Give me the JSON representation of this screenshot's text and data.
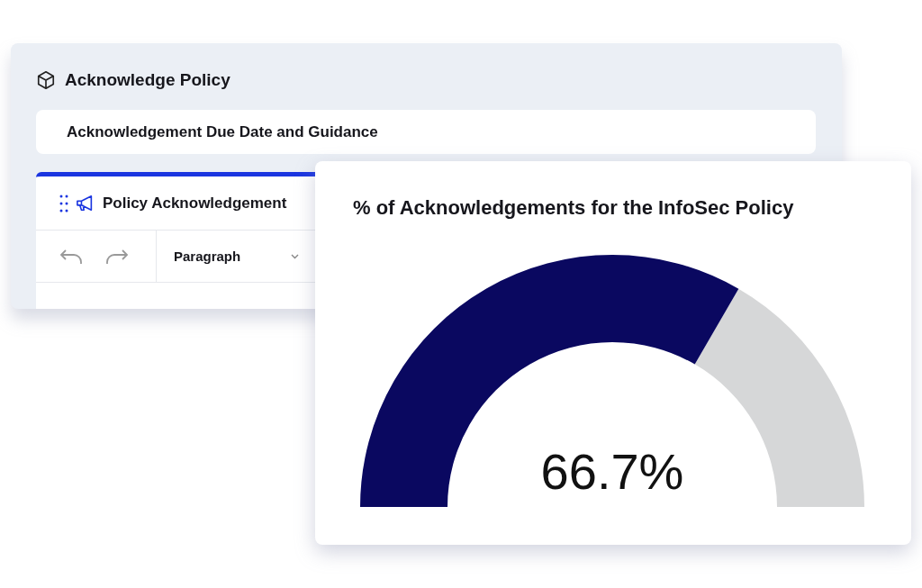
{
  "panel": {
    "title": "Acknowledge Policy",
    "guidance": "Acknowledgement Due Date and Guidance",
    "editor": {
      "title": "Policy Acknowledgement",
      "block_style": "Paragraph"
    }
  },
  "gauge_card": {
    "title": "% of Acknowledgements for the InfoSec Policy",
    "reading": "66.7%"
  }
}
